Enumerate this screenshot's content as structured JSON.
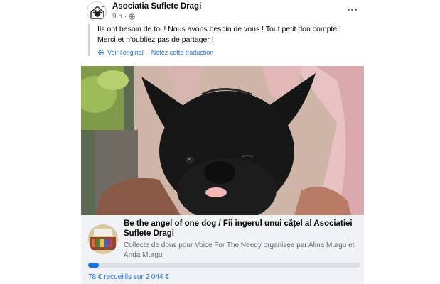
{
  "post": {
    "page_name": "Asociatia Suflete Dragi",
    "timestamp": "9 h",
    "text": "Ils ont besoin de toi ! Nous avons besoin de vous ! Tout petit don compte ! Merci et n'oubliez pas de partager !",
    "see_original": "Voir l'original",
    "separator": "·",
    "rate_translation": "Notez cette traduction"
  },
  "fundraiser": {
    "title": "Be the angel of one dog / Fii ingerul unui cățel al Asociatiei Suflete Dragi",
    "subtitle": "Collecte de dons pour Voice For The Needy organisée par Alina Murgu et Anda Murgu",
    "raised_text": "78 € recueillis sur 2 044 €",
    "progress_fraction": 0.038
  },
  "colors": {
    "link_blue": "#216fdb",
    "progress_blue": "#1b74e4",
    "fundraiser_bg": "#f0f2f5"
  },
  "icons": [
    "page-avatar-icon",
    "globe-icon",
    "more-options-icon",
    "translate-gear-icon"
  ]
}
